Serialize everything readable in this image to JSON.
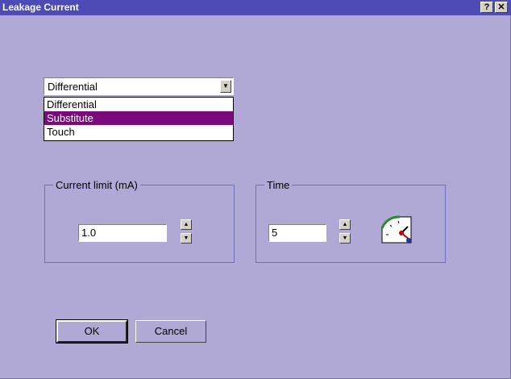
{
  "window": {
    "title": "Leakage Current",
    "help_label": "?",
    "close_label": "✕"
  },
  "mode_select": {
    "selected": "Differential",
    "options": [
      {
        "label": "Differential",
        "highlighted": false
      },
      {
        "label": "Substitute",
        "highlighted": true
      },
      {
        "label": "Touch",
        "highlighted": false
      }
    ]
  },
  "current_limit": {
    "label": "Current limit (mA)",
    "value": "1.0"
  },
  "time": {
    "label": "Time",
    "value": "5"
  },
  "buttons": {
    "ok": "OK",
    "cancel": "Cancel"
  },
  "icons": {
    "spin_up": "spin-up-arrow",
    "spin_down": "spin-down-arrow",
    "timer": "clock-timer-icon",
    "dropdown": "dropdown-arrow"
  },
  "colors": {
    "title_bar": "#4d4bb5",
    "dialog_bg": "#b0a9d6",
    "selection": "#7b0b7b"
  }
}
